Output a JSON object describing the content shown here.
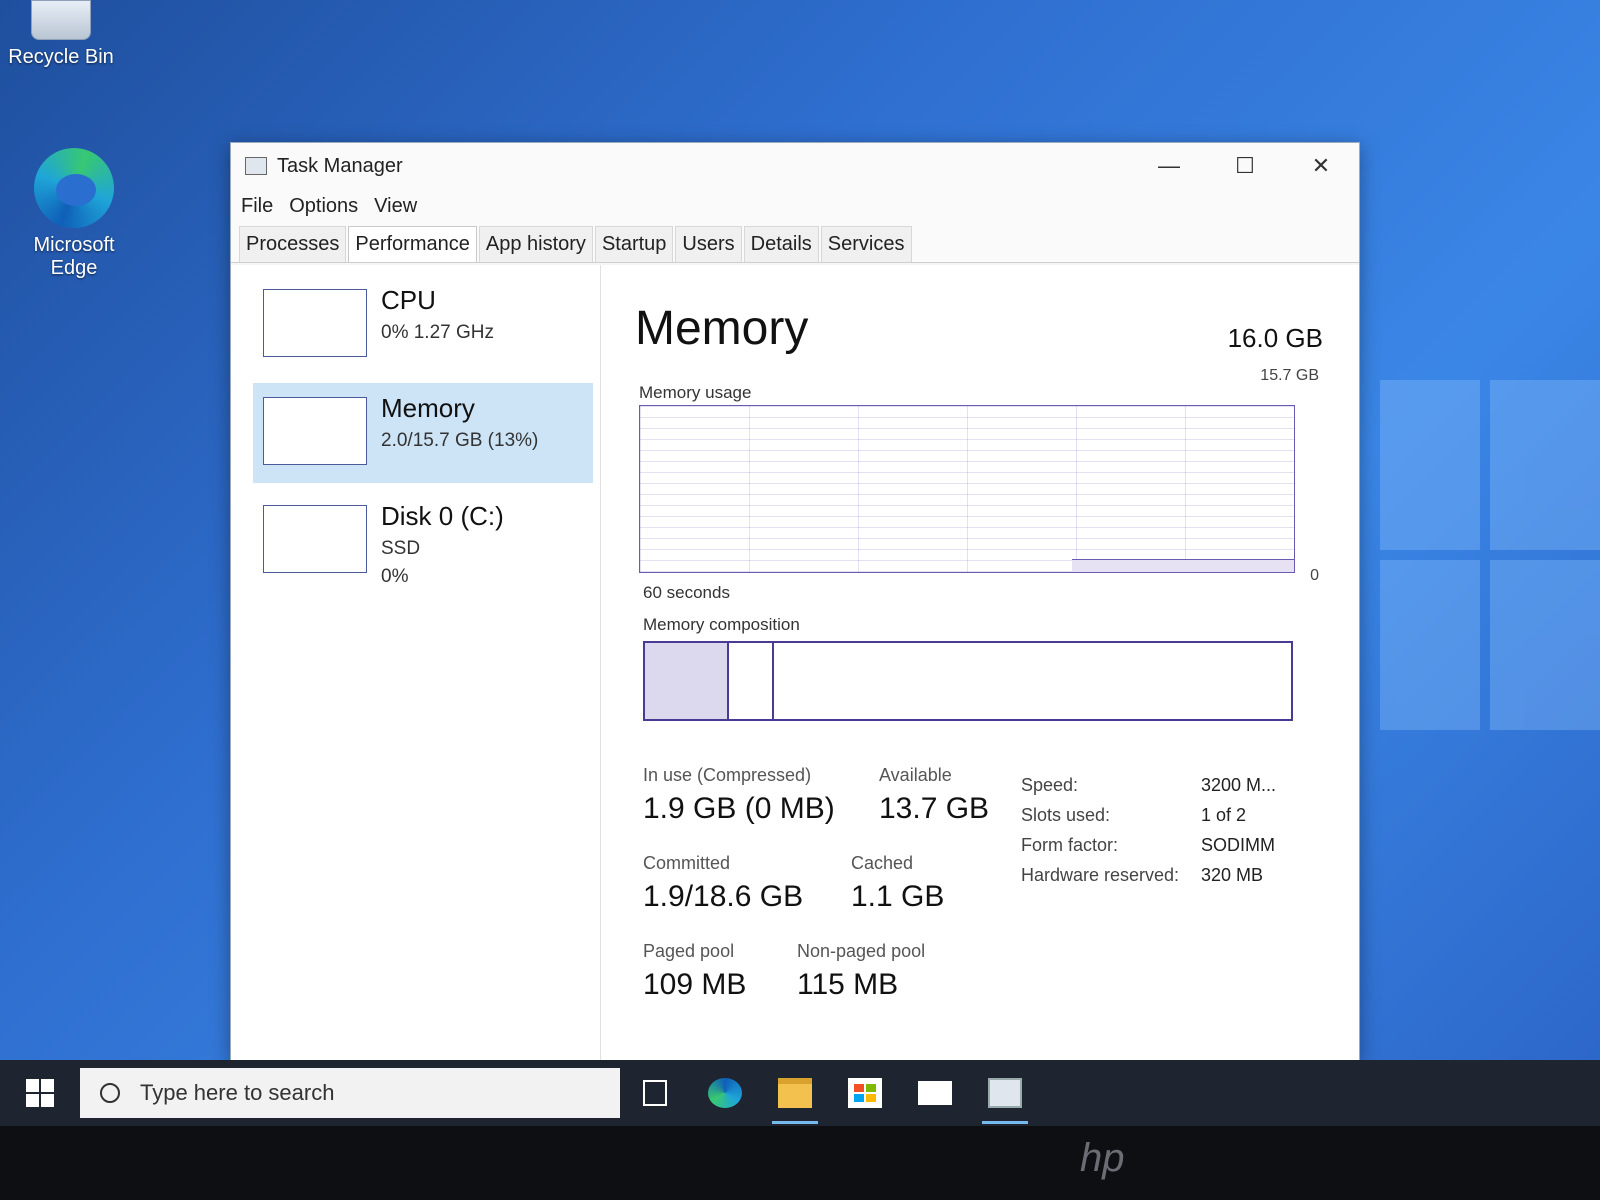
{
  "desktop": {
    "recycle_bin_label": "Recycle Bin",
    "edge_label_line1": "Microsoft",
    "edge_label_line2": "Edge"
  },
  "window": {
    "title": "Task Manager",
    "controls": {
      "minimize": "—",
      "maximize": "☐",
      "close": "✕"
    }
  },
  "menu": [
    "File",
    "Options",
    "View"
  ],
  "tabs": [
    "Processes",
    "Performance",
    "App history",
    "Startup",
    "Users",
    "Details",
    "Services"
  ],
  "active_tab": "Performance",
  "resources": [
    {
      "title": "CPU",
      "sub1": "0%  1.27 GHz",
      "sub2": ""
    },
    {
      "title": "Memory",
      "sub1": "2.0/15.7 GB (13%)",
      "sub2": ""
    },
    {
      "title": "Disk 0 (C:)",
      "sub1": "SSD",
      "sub2": "0%"
    }
  ],
  "memory": {
    "title": "Memory",
    "total": "16.0 GB",
    "graph_max": "15.7 GB",
    "usage_label": "Memory usage",
    "time_label": "60 seconds",
    "graph_min": "0",
    "usage_fraction": 0.13,
    "composition_label": "Memory composition",
    "composition_inuse_fraction": 0.13,
    "composition_modified_fraction": 0.07,
    "in_use_label": "In use (Compressed)",
    "in_use_value": "1.9 GB (0 MB)",
    "available_label": "Available",
    "available_value": "13.7 GB",
    "committed_label": "Committed",
    "committed_value": "1.9/18.6 GB",
    "cached_label": "Cached",
    "cached_value": "1.1 GB",
    "paged_label": "Paged pool",
    "paged_value": "109 MB",
    "nonpaged_label": "Non-paged pool",
    "nonpaged_value": "115 MB",
    "specs": [
      {
        "k": "Speed:",
        "v": "3200 M..."
      },
      {
        "k": "Slots used:",
        "v": "1 of 2"
      },
      {
        "k": "Form factor:",
        "v": "SODIMM"
      },
      {
        "k": "Hardware reserved:",
        "v": "320 MB"
      }
    ]
  },
  "taskbar": {
    "search_placeholder": "Type here to search"
  },
  "colors": {
    "accent": "#4a3a96",
    "selected": "#cde4f7",
    "taskbar": "#1e2430"
  }
}
